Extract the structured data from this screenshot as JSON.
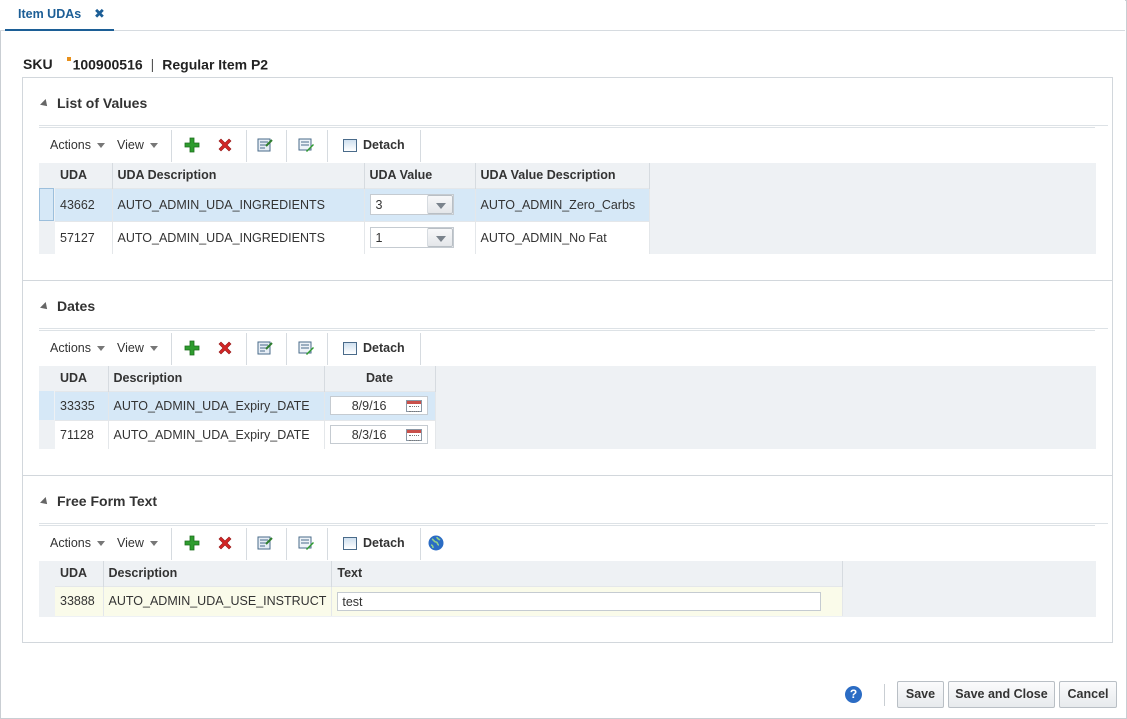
{
  "tab": {
    "label": "Item UDAs",
    "close": "✖"
  },
  "header": {
    "sku_label": "SKU",
    "sku_value": "100900516",
    "separator": "|",
    "item_desc": "Regular Item P2"
  },
  "toolbar": {
    "actions": "Actions",
    "view": "View",
    "detach": "Detach"
  },
  "list_of_values": {
    "title": "List of Values",
    "columns": [
      "UDA",
      "UDA Description",
      "UDA Value",
      "UDA Value Description"
    ],
    "rows": [
      {
        "uda": "43662",
        "desc": "AUTO_ADMIN_UDA_INGREDIENTS",
        "value": "3",
        "value_desc": "AUTO_ADMIN_Zero_Carbs"
      },
      {
        "uda": "57127",
        "desc": "AUTO_ADMIN_UDA_INGREDIENTS",
        "value": "1",
        "value_desc": "AUTO_ADMIN_No Fat"
      }
    ]
  },
  "dates": {
    "title": "Dates",
    "columns": [
      "UDA",
      "Description",
      "Date"
    ],
    "rows": [
      {
        "uda": "33335",
        "desc": "AUTO_ADMIN_UDA_Expiry_DATE",
        "date": "8/9/16"
      },
      {
        "uda": "71128",
        "desc": "AUTO_ADMIN_UDA_Expiry_DATE",
        "date": "8/3/16"
      }
    ]
  },
  "free_form": {
    "title": "Free Form Text",
    "columns": [
      "UDA",
      "Description",
      "Text"
    ],
    "rows": [
      {
        "uda": "33888",
        "desc": "AUTO_ADMIN_UDA_USE_INSTRUCT",
        "text": "test"
      }
    ]
  },
  "footer": {
    "help": "?",
    "save": "Save",
    "save_close": "Save and Close",
    "cancel": "Cancel"
  },
  "colors": {
    "accent": "#1c5e96",
    "selected_row": "#d6e8f7",
    "add_icon": "#2e9c2e",
    "delete_icon": "#d32626"
  }
}
